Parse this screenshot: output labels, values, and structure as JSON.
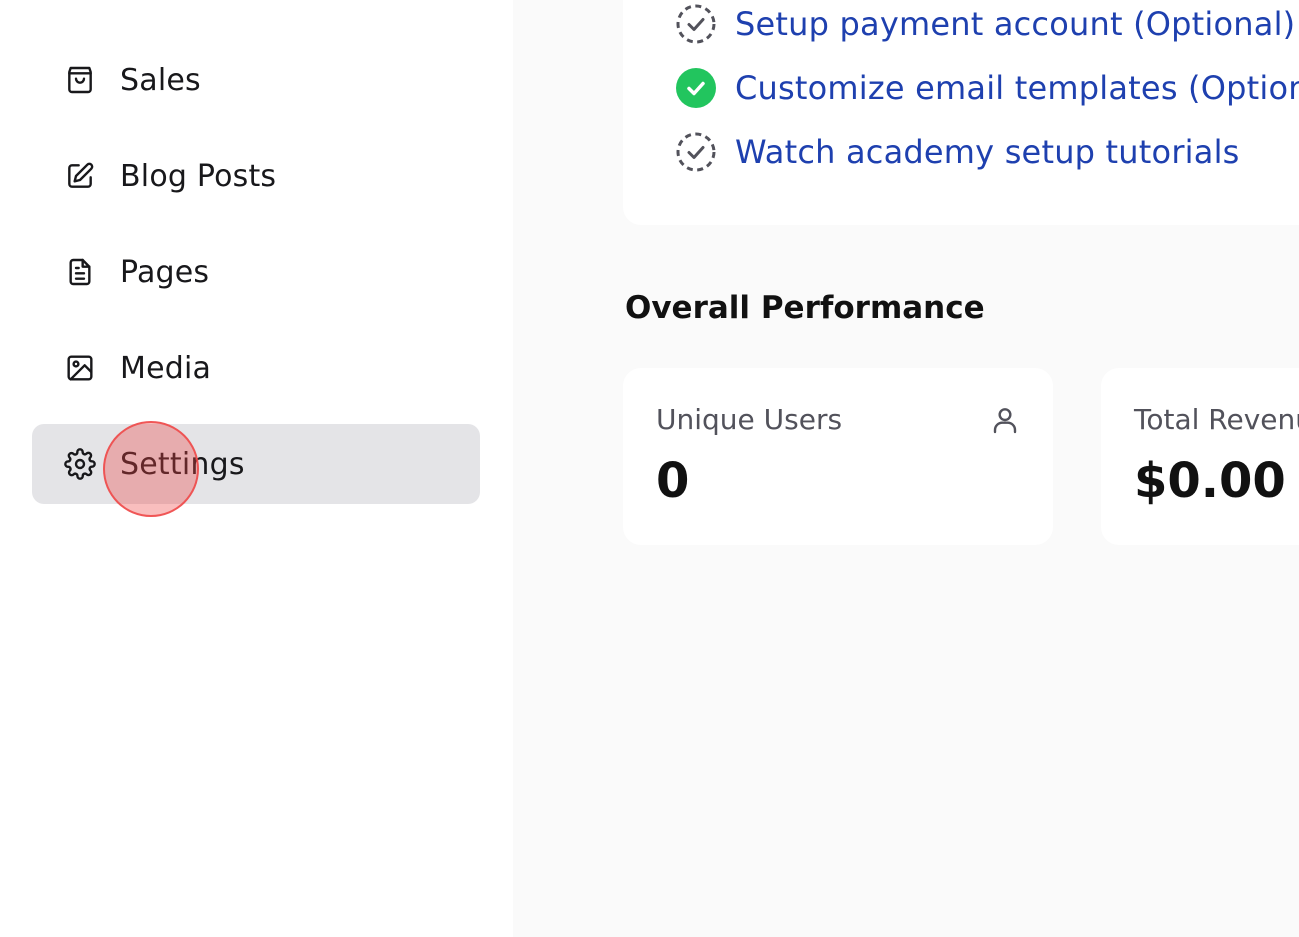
{
  "sidebar": {
    "items": [
      {
        "label": "Sales",
        "icon": "shopping-bag-icon",
        "active": false
      },
      {
        "label": "Blog Posts",
        "icon": "edit-icon",
        "active": false
      },
      {
        "label": "Pages",
        "icon": "document-icon",
        "active": false
      },
      {
        "label": "Media",
        "icon": "image-icon",
        "active": false
      },
      {
        "label": "Settings",
        "icon": "gear-icon",
        "active": true
      }
    ]
  },
  "checklist": {
    "items": [
      {
        "label": "Setup payment account (Optional)",
        "status": "pending"
      },
      {
        "label": "Customize email templates (Optional)",
        "status": "done"
      },
      {
        "label": "Watch academy setup tutorials",
        "status": "pending"
      }
    ]
  },
  "performance": {
    "title": "Overall Performance",
    "unique_users": {
      "label": "Unique Users",
      "value": "0",
      "icon": "user-icon"
    },
    "total_revenue": {
      "label": "Total Revenue",
      "value": "$0.00"
    }
  },
  "colors": {
    "active_bg": "#e4e4e7",
    "link_blue": "#1e40af",
    "done_green": "#22c55e",
    "pending_gray": "#52525b",
    "click_indicator": "#ef4444"
  }
}
